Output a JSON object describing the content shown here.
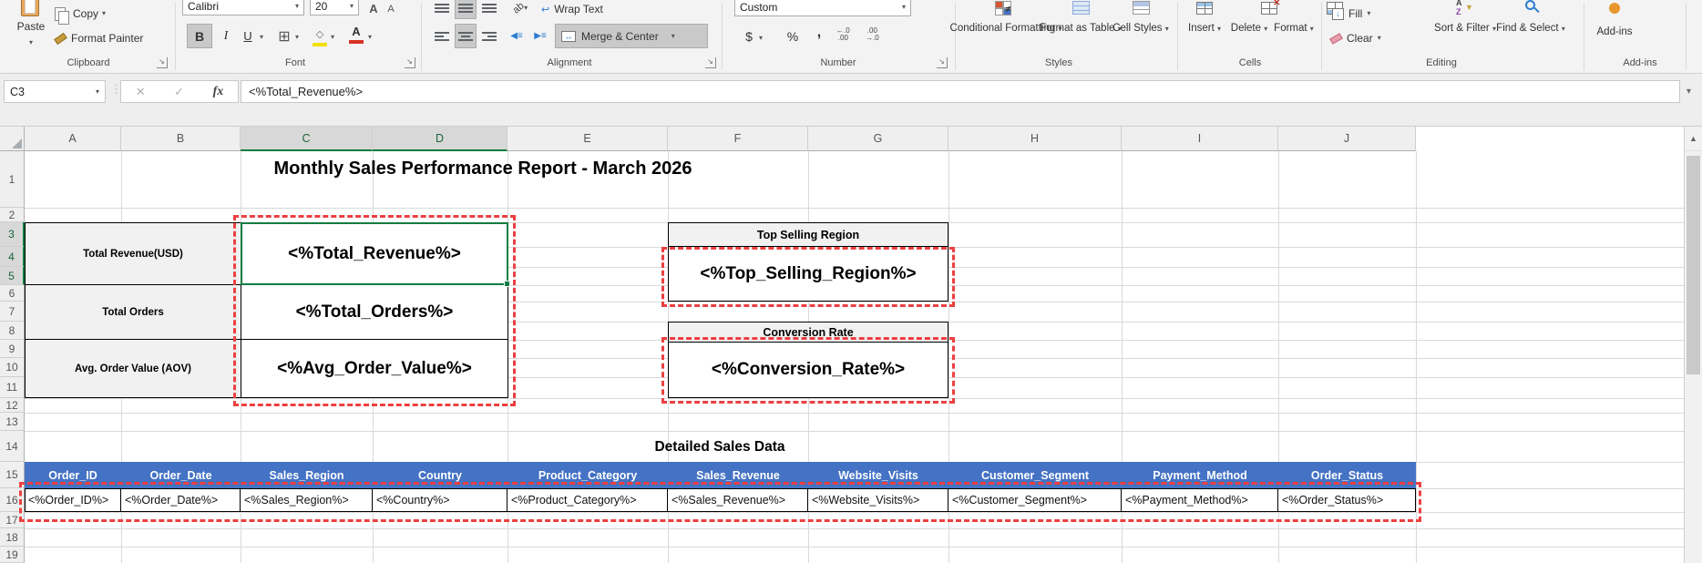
{
  "colors": {
    "header_blue": "#4472C4",
    "selection_green": "#107C41",
    "marquee_red": "#EC4040",
    "fill_yellow": "#F1E000",
    "font_red": "#D93025",
    "addins_orange": "#E8972E"
  },
  "icons": {
    "dropdown": "▾",
    "dialog_launcher": "↘",
    "cancel": "✕",
    "enter": "✓",
    "fx": "fx",
    "scroll_up": "▲",
    "increase_decimal_line1": "←.0",
    "increase_decimal_line2": ".00",
    "decrease_decimal_line1": ".00",
    "decrease_decimal_line2": "→.0",
    "merge_arrows": "↔",
    "wrap_arrow": "↩",
    "fill_arrow": "↓",
    "not_equal": "≠",
    "sort_a": "A",
    "sort_z": "Z",
    "funnel": "▼"
  },
  "ribbon": {
    "clipboard": {
      "paste": "Paste",
      "copy": "Copy",
      "format_painter": "Format Painter",
      "label": "Clipboard"
    },
    "font": {
      "family": "Calibri",
      "size": "20",
      "bold": "B",
      "italic": "I",
      "underline": "U",
      "label": "Font"
    },
    "alignment": {
      "wrap_text": "Wrap Text",
      "merge_center": "Merge & Center",
      "label": "Alignment"
    },
    "number": {
      "format": "Custom",
      "currency": "$",
      "percent": "%",
      "comma": ",",
      "label": "Number"
    },
    "styles": {
      "conditional1": "Conditional",
      "conditional2": "Formatting",
      "format_table1": "Format as",
      "format_table2": "Table",
      "cell_styles1": "Cell",
      "cell_styles2": "Styles",
      "label": "Styles"
    },
    "cells": {
      "insert": "Insert",
      "del": "Delete",
      "format": "Format",
      "label": "Cells"
    },
    "editing": {
      "fill": "Fill",
      "clear": "Clear",
      "sort1": "Sort &",
      "sort2": "Filter",
      "find1": "Find &",
      "find2": "Select",
      "label": "Editing"
    },
    "addins": {
      "button": "Add-ins",
      "label": "Add-ins"
    }
  },
  "formula_bar": {
    "name_box": "C3",
    "formula": "<%Total_Revenue%>"
  },
  "sheet": {
    "columns": [
      "A",
      "B",
      "C",
      "D",
      "E",
      "F",
      "G",
      "H",
      "I",
      "J"
    ],
    "rows": [
      "1",
      "2",
      "3",
      "4",
      "5",
      "6",
      "7",
      "8",
      "9",
      "10",
      "11",
      "12",
      "13",
      "14",
      "15",
      "16",
      "17",
      "18",
      "19"
    ],
    "title": "Monthly Sales Performance Report - March 2026",
    "summary": [
      {
        "label": "Total Revenue(USD)",
        "value": "<%Total_Revenue%>"
      },
      {
        "label": "Total Orders",
        "value": "<%Total_Orders%>"
      },
      {
        "label": "Avg. Order Value (AOV)",
        "value": "<%Avg_Order_Value%>"
      }
    ],
    "kpis": [
      {
        "header": "Top Selling Region",
        "value": "<%Top_Selling_Region%>"
      },
      {
        "header": "Conversion Rate",
        "value": "<%Conversion_Rate%>"
      }
    ],
    "table": {
      "title": "Detailed Sales Data",
      "headers": [
        "Order_ID",
        "Order_Date",
        "Sales_Region",
        "Country",
        "Product_Category",
        "Sales_Revenue",
        "Website_Visits",
        "Customer_Segment",
        "Payment_Method",
        "Order_Status"
      ],
      "values": [
        "<%Order_ID%>",
        "<%Order_Date%>",
        "<%Sales_Region%>",
        "<%Country%>",
        "<%Product_Category%>",
        "<%Sales_Revenue%>",
        "<%Website_Visits%>",
        "<%Customer_Segment%>",
        "<%Payment_Method%>",
        "<%Order_Status%>"
      ]
    }
  }
}
